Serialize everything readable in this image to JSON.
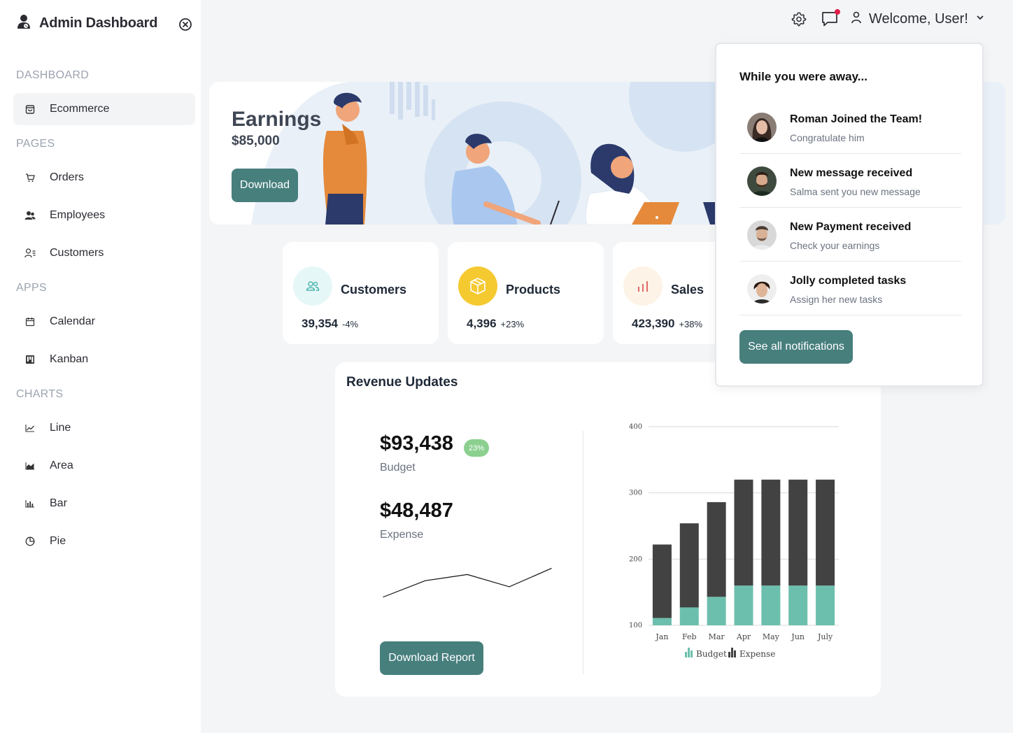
{
  "sidebar": {
    "title": "Admin Dashboard",
    "sections": [
      {
        "label": "DASHBOARD"
      },
      {
        "label": "PAGES"
      },
      {
        "label": "APPS"
      },
      {
        "label": "CHARTS"
      }
    ],
    "items": [
      {
        "label": "Ecommerce",
        "icon": "shopping-bag-icon",
        "active": true
      },
      {
        "label": "Orders",
        "icon": "cart-icon"
      },
      {
        "label": "Employees",
        "icon": "employees-icon"
      },
      {
        "label": "Customers",
        "icon": "customers-icon"
      },
      {
        "label": "Calendar",
        "icon": "calendar-icon"
      },
      {
        "label": "Kanban",
        "icon": "kanban-icon"
      },
      {
        "label": "Line",
        "icon": "line-chart-icon"
      },
      {
        "label": "Area",
        "icon": "area-chart-icon"
      },
      {
        "label": "Bar",
        "icon": "bar-chart-icon"
      },
      {
        "label": "Pie",
        "icon": "pie-chart-icon"
      }
    ]
  },
  "topbar": {
    "greeting": "Welcome, User!",
    "has_unread": true,
    "dot_color": "#e11d48"
  },
  "earnings": {
    "title": "Earnings",
    "amount": "$85,000",
    "button": "Download"
  },
  "stats": [
    {
      "title": "Customers",
      "amount": "39,354",
      "change": "-4%",
      "icon": "customers-icon",
      "circle_color": "#e6f7f7"
    },
    {
      "title": "Products",
      "amount": "4,396",
      "change": "+23%",
      "icon": "box-icon",
      "circle_color": "#f5c930"
    },
    {
      "title": "Sales",
      "amount": "423,390",
      "change": "+38%",
      "icon": "bar-chart-icon",
      "circle_color": "#fdf3e6"
    }
  ],
  "revenue": {
    "title": "Revenue Updates",
    "budget": "$93,438",
    "budget_badge": "23%",
    "budget_label": "Budget",
    "expense": "$48,487",
    "expense_label": "Expense",
    "button": "Download Report"
  },
  "notifications": {
    "heading": "While you were away...",
    "items": [
      {
        "title": "Roman Joined the Team!",
        "subtitle": "Congratulate him"
      },
      {
        "title": "New message received",
        "subtitle": "Salma sent you new message"
      },
      {
        "title": "New Payment received",
        "subtitle": "Check your earnings"
      },
      {
        "title": "Jolly completed tasks",
        "subtitle": "Assign her new tasks"
      }
    ],
    "button": "See all notifications"
  },
  "chart_data": [
    {
      "type": "line",
      "x": [
        1,
        2,
        3,
        4,
        5
      ],
      "series": [
        {
          "values": [
            3,
            7,
            8.5,
            5.5,
            10
          ]
        }
      ]
    },
    {
      "type": "bar",
      "stacked": true,
      "categories": [
        "Jan",
        "Feb",
        "Mar",
        "Apr",
        "May",
        "Jun",
        "July"
      ],
      "series": [
        {
          "name": "Budget",
          "values": [
            111,
            127,
            143,
            160,
            160,
            160,
            160
          ],
          "color": "#6cbfac"
        },
        {
          "name": "Expense",
          "values": [
            111,
            127,
            143,
            160,
            160,
            160,
            160
          ],
          "color": "#424242"
        }
      ],
      "yticks": [
        100,
        200,
        300,
        400
      ],
      "ylim": [
        100,
        400
      ],
      "legend": "bottom"
    }
  ],
  "colors": {
    "accent": "#477f7d",
    "badge": "#8bd08f"
  }
}
